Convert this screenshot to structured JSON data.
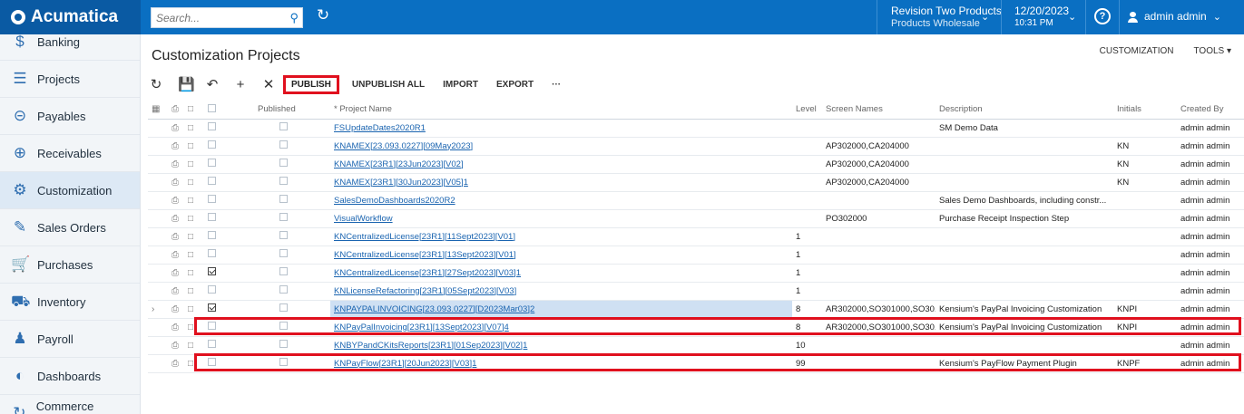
{
  "app": {
    "logo": "Acumatica"
  },
  "topbar": {
    "search_placeholder": "Search...",
    "branch_line1": "Revision Two Products",
    "branch_line2": "Products Wholesale",
    "date_line1": "12/20/2023",
    "date_line2": "10:31 PM",
    "user": "admin admin"
  },
  "sidebar": {
    "items": [
      {
        "label": "Banking",
        "icon": "dollar-icon"
      },
      {
        "label": "Projects",
        "icon": "projects-icon"
      },
      {
        "label": "Payables",
        "icon": "minus-circle-icon"
      },
      {
        "label": "Receivables",
        "icon": "plus-circle-icon"
      },
      {
        "label": "Customization",
        "icon": "puzzle-icon",
        "active": true
      },
      {
        "label": "Sales Orders",
        "icon": "edit-icon"
      },
      {
        "label": "Purchases",
        "icon": "cart-icon"
      },
      {
        "label": "Inventory",
        "icon": "truck-icon"
      },
      {
        "label": "Payroll",
        "icon": "people-icon"
      },
      {
        "label": "Dashboards",
        "icon": "dashboard-icon"
      },
      {
        "label": "Commerce Connec...",
        "icon": "commerce-icon"
      }
    ]
  },
  "page": {
    "title": "Customization Projects",
    "customization_link": "CUSTOMIZATION",
    "tools_link": "TOOLS ▾"
  },
  "toolbar": {
    "publish": "PUBLISH",
    "unpublish_all": "UNPUBLISH ALL",
    "import": "IMPORT",
    "export": "EXPORT",
    "more": "···"
  },
  "table": {
    "headers": {
      "published": "Published",
      "project_name": "* Project Name",
      "level": "Level",
      "screen_names": "Screen Names",
      "description": "Description",
      "initials": "Initials",
      "created_by": "Created By"
    },
    "rows": [
      {
        "selected": false,
        "published": false,
        "name": "FSUpdateDates2020R1",
        "level": "",
        "screens": "",
        "description": "SM Demo Data",
        "initials": "",
        "created_by": "admin admin"
      },
      {
        "selected": false,
        "published": false,
        "name": "KNAMEX[23.093.0227][09May2023]",
        "level": "",
        "screens": "AP302000,CA204000",
        "description": "",
        "initials": "KN",
        "created_by": "admin admin"
      },
      {
        "selected": false,
        "published": false,
        "name": "KNAMEX[23R1][23Jun2023][V02]",
        "level": "",
        "screens": "AP302000,CA204000",
        "description": "",
        "initials": "KN",
        "created_by": "admin admin"
      },
      {
        "selected": false,
        "published": false,
        "name": "KNAMEX[23R1][30Jun2023][V05]1",
        "level": "",
        "screens": "AP302000,CA204000",
        "description": "",
        "initials": "KN",
        "created_by": "admin admin"
      },
      {
        "selected": false,
        "published": false,
        "name": "SalesDemoDashboards2020R2",
        "level": "",
        "screens": "",
        "description": "Sales Demo Dashboards, including constr...",
        "initials": "",
        "created_by": "admin admin"
      },
      {
        "selected": false,
        "published": false,
        "name": "VisualWorkflow",
        "level": "",
        "screens": "PO302000",
        "description": "Purchase Receipt Inspection Step",
        "initials": "",
        "created_by": "admin admin"
      },
      {
        "selected": false,
        "published": false,
        "name": "KNCentralizedLicense[23R1][11Sept2023][V01]",
        "level": "1",
        "screens": "",
        "description": "",
        "initials": "",
        "created_by": "admin admin"
      },
      {
        "selected": false,
        "published": false,
        "name": "KNCentralizedLicense[23R1][13Sept2023][V01]",
        "level": "1",
        "screens": "",
        "description": "",
        "initials": "",
        "created_by": "admin admin"
      },
      {
        "selected": true,
        "published": false,
        "name": "KNCentralizedLicense[23R1][27Sept2023][V03]1",
        "level": "1",
        "screens": "",
        "description": "",
        "initials": "",
        "created_by": "admin admin"
      },
      {
        "selected": false,
        "published": false,
        "name": "KNLicenseRefactoring[23R1][05Sept2023][V03]",
        "level": "1",
        "screens": "",
        "description": "",
        "initials": "",
        "created_by": "admin admin"
      },
      {
        "selected": true,
        "published": false,
        "current": true,
        "name": "KNPAYPALINVOICING[23.093.0227][D2023Mar03]2",
        "level": "8",
        "screens": "AR302000,SO301000,SO30...",
        "description": "Kensium's PayPal Invoicing Customization",
        "initials": "KNPI",
        "created_by": "admin admin"
      },
      {
        "selected": false,
        "published": false,
        "name": "KNPayPalInvoicing[23R1][13Sept2023][V07]4",
        "level": "8",
        "screens": "AR302000,SO301000,SO30...",
        "description": "Kensium's PayPal Invoicing Customization",
        "initials": "KNPI",
        "created_by": "admin admin"
      },
      {
        "selected": false,
        "published": false,
        "name": "KNBYPandCKitsReports[23R1][01Sep2023][V02]1",
        "level": "10",
        "screens": "",
        "description": "",
        "initials": "",
        "created_by": "admin admin"
      },
      {
        "selected": false,
        "published": false,
        "name": "KNPayFlow[23R1][20Jun2023][V03]1",
        "level": "99",
        "screens": "",
        "description": "Kensium's PayFlow Payment Plugin",
        "initials": "KNPF",
        "created_by": "admin admin"
      }
    ]
  }
}
